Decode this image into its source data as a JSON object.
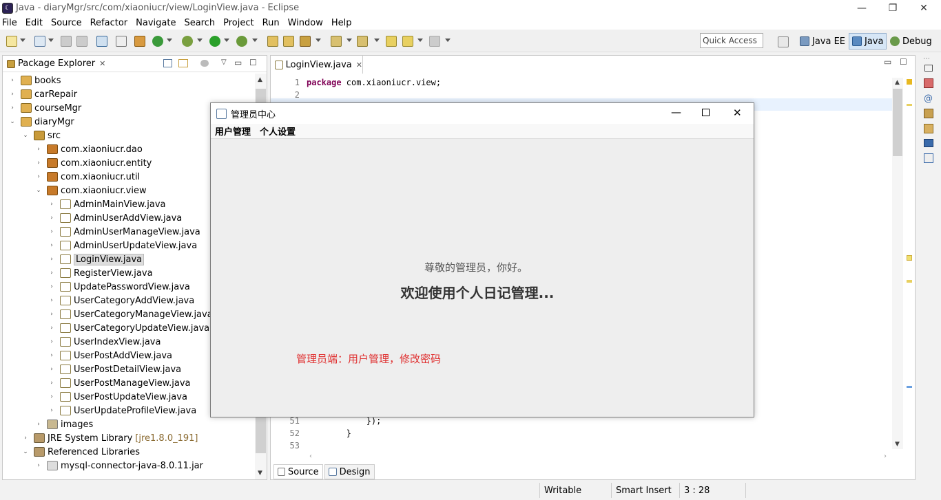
{
  "window": {
    "title": "Java - diaryMgr/src/com/xiaoniucr/view/LoginView.java - Eclipse",
    "minimize": "—",
    "restore": "❐",
    "close": "✕"
  },
  "menu": [
    "File",
    "Edit",
    "Source",
    "Refactor",
    "Navigate",
    "Search",
    "Project",
    "Run",
    "Window",
    "Help"
  ],
  "quick_access": "Quick Access",
  "perspectives": [
    "Java EE",
    "Java",
    "Debug"
  ],
  "package_explorer": {
    "title": "Package Explorer",
    "tree": [
      {
        "label": "books",
        "depth": 0,
        "arrow": "›",
        "icon": "proj"
      },
      {
        "label": "carRepair",
        "depth": 0,
        "arrow": "›",
        "icon": "proj"
      },
      {
        "label": "courseMgr",
        "depth": 0,
        "arrow": "›",
        "icon": "proj"
      },
      {
        "label": "diaryMgr",
        "depth": 0,
        "arrow": "⌄",
        "icon": "proj"
      },
      {
        "label": "src",
        "depth": 1,
        "arrow": "⌄",
        "icon": "src"
      },
      {
        "label": "com.xiaoniucr.dao",
        "depth": 2,
        "arrow": "›",
        "icon": "pkg"
      },
      {
        "label": "com.xiaoniucr.entity",
        "depth": 2,
        "arrow": "›",
        "icon": "pkg"
      },
      {
        "label": "com.xiaoniucr.util",
        "depth": 2,
        "arrow": "›",
        "icon": "pkg"
      },
      {
        "label": "com.xiaoniucr.view",
        "depth": 2,
        "arrow": "⌄",
        "icon": "pkg"
      },
      {
        "label": "AdminMainView.java",
        "depth": 3,
        "arrow": "›",
        "icon": "jf"
      },
      {
        "label": "AdminUserAddView.java",
        "depth": 3,
        "arrow": "›",
        "icon": "jf"
      },
      {
        "label": "AdminUserManageView.java",
        "depth": 3,
        "arrow": "›",
        "icon": "jf"
      },
      {
        "label": "AdminUserUpdateView.java",
        "depth": 3,
        "arrow": "›",
        "icon": "jf"
      },
      {
        "label": "LoginView.java",
        "depth": 3,
        "arrow": "›",
        "icon": "jf",
        "selected": true
      },
      {
        "label": "RegisterView.java",
        "depth": 3,
        "arrow": "›",
        "icon": "jf"
      },
      {
        "label": "UpdatePasswordView.java",
        "depth": 3,
        "arrow": "›",
        "icon": "jf"
      },
      {
        "label": "UserCategoryAddView.java",
        "depth": 3,
        "arrow": "›",
        "icon": "jf"
      },
      {
        "label": "UserCategoryManageView.java",
        "depth": 3,
        "arrow": "›",
        "icon": "jf"
      },
      {
        "label": "UserCategoryUpdateView.java",
        "depth": 3,
        "arrow": "›",
        "icon": "jf"
      },
      {
        "label": "UserIndexView.java",
        "depth": 3,
        "arrow": "›",
        "icon": "jf"
      },
      {
        "label": "UserPostAddView.java",
        "depth": 3,
        "arrow": "›",
        "icon": "jf"
      },
      {
        "label": "UserPostDetailView.java",
        "depth": 3,
        "arrow": "›",
        "icon": "jf"
      },
      {
        "label": "UserPostManageView.java",
        "depth": 3,
        "arrow": "›",
        "icon": "jf"
      },
      {
        "label": "UserPostUpdateView.java",
        "depth": 3,
        "arrow": "›",
        "icon": "jf"
      },
      {
        "label": "UserUpdateProfileView.java",
        "depth": 3,
        "arrow": "›",
        "icon": "jf"
      },
      {
        "label": "images",
        "depth": 2,
        "arrow": "›",
        "icon": "fld"
      },
      {
        "label": "JRE System Library",
        "suffix": "[jre1.8.0_191]",
        "depth": 1,
        "arrow": "›",
        "icon": "lib"
      },
      {
        "label": "Referenced Libraries",
        "depth": 1,
        "arrow": "⌄",
        "icon": "lib"
      },
      {
        "label": "mysql-connector-java-8.0.11.jar",
        "depth": 2,
        "arrow": "›",
        "icon": "jar"
      }
    ]
  },
  "editor": {
    "tab": "LoginView.java",
    "lines_top": [
      {
        "n": "1",
        "kw": "package",
        "rest": " com.xiaoniucr.view;"
      },
      {
        "n": "2",
        "kw": "",
        "rest": ""
      }
    ],
    "lines_bottom": [
      {
        "n": "51",
        "text": "            });"
      },
      {
        "n": "52",
        "text": "        }"
      },
      {
        "n": "53",
        "text": ""
      }
    ],
    "bottom_tabs": [
      "Source",
      "Design"
    ]
  },
  "dialog": {
    "title": "管理员中心",
    "menu": [
      "用户管理",
      "个人设置"
    ],
    "greeting": "尊敬的管理员，你好。",
    "welcome": "欢迎使用个人日记管理...",
    "note": "管理员端：用户管理，修改密码",
    "note_color": "#e03030"
  },
  "status": {
    "writable": "Writable",
    "insert": "Smart Insert",
    "position": "3 : 28"
  }
}
